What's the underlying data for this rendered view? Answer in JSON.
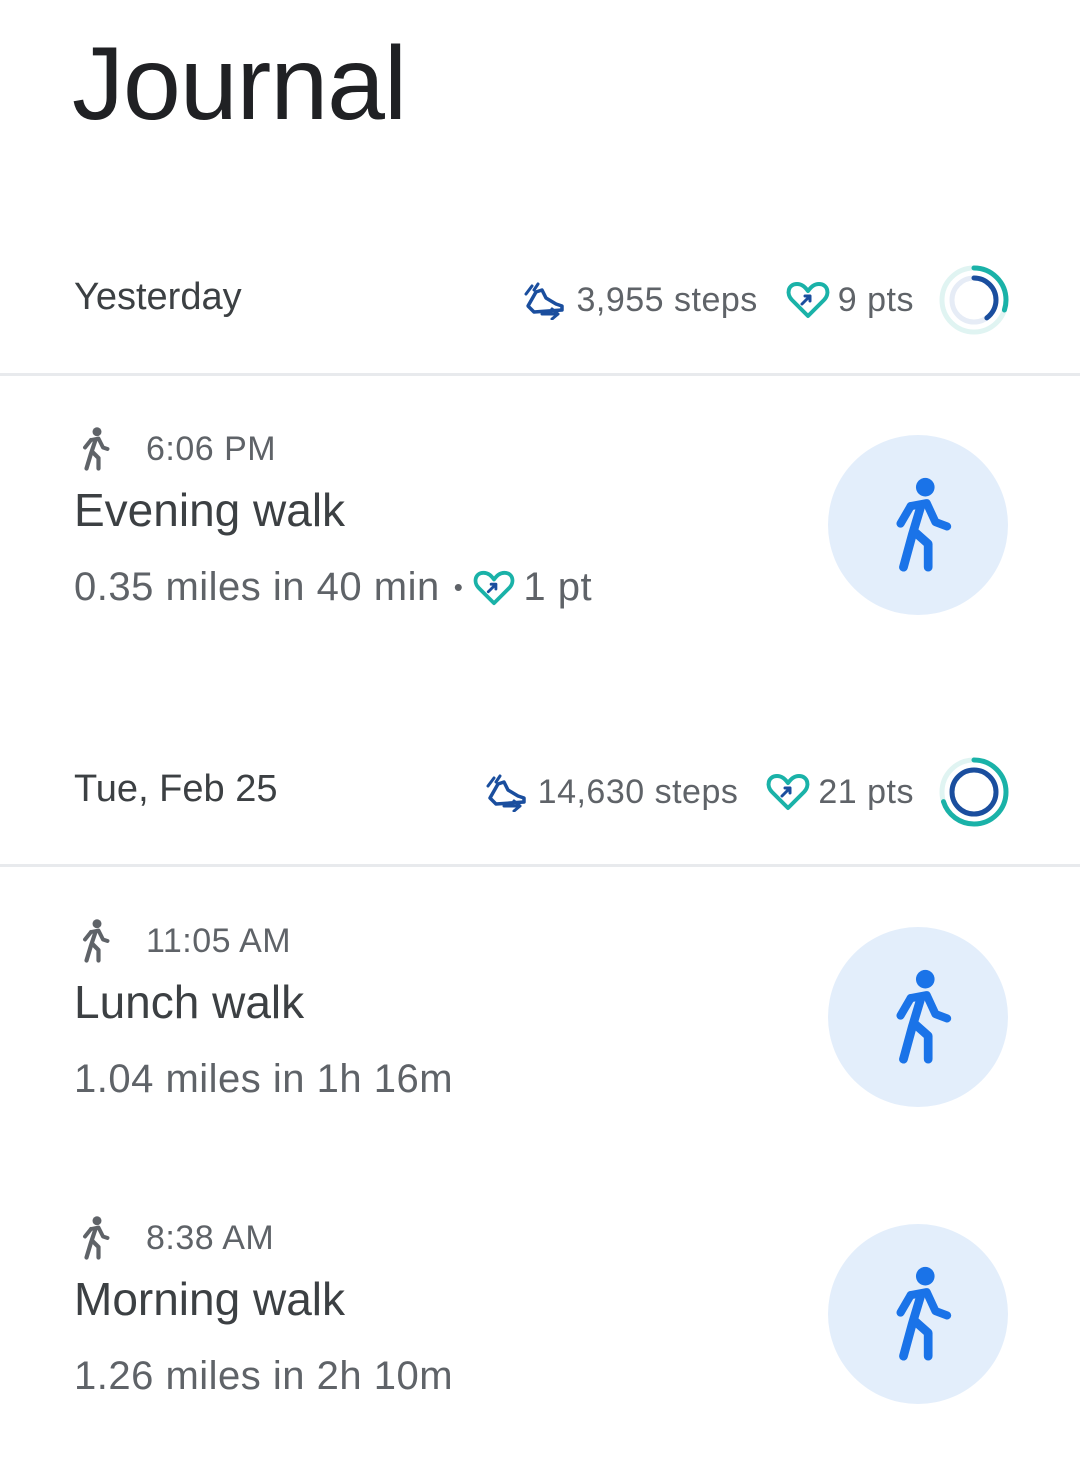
{
  "page": {
    "title": "Journal"
  },
  "days": [
    {
      "label": "Yesterday",
      "steps": "3,955 steps",
      "points": "9 pts",
      "ring": {
        "steps_progress": 0.4,
        "points_progress": 0.3
      },
      "activities": [
        {
          "time": "6:06 PM",
          "title": "Evening walk",
          "distance_duration": "0.35 miles in 40 min",
          "points": "1 pt",
          "icon": "walking-icon"
        }
      ]
    },
    {
      "label": "Tue, Feb 25",
      "steps": "14,630 steps",
      "points": "21 pts",
      "ring": {
        "steps_progress": 1.0,
        "points_progress": 0.7
      },
      "activities": [
        {
          "time": "11:05 AM",
          "title": "Lunch walk",
          "distance_duration": "1.04 miles in 1h 16m",
          "icon": "walking-icon"
        },
        {
          "time": "8:38 AM",
          "title": "Morning walk",
          "distance_duration": "1.26 miles in 2h 10m",
          "icon": "walking-icon"
        }
      ]
    }
  ],
  "colors": {
    "steps_blue": "#1a4e9e",
    "points_teal": "#1ab2a8",
    "activity_blue": "#1a73e8",
    "avatar_bg": "#e3eefb",
    "ring_track": "#e0f4f2"
  }
}
